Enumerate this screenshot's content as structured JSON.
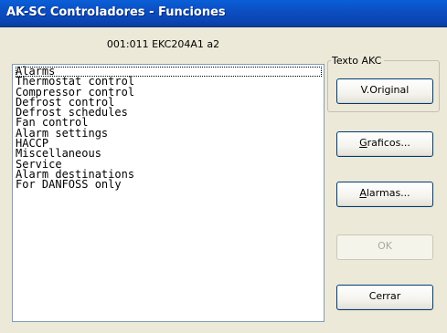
{
  "window": {
    "title": "AK-SC Controladores - Funciones"
  },
  "device_line": "001:011  EKC204A1 a2",
  "list": {
    "items": [
      "Alarms",
      "Thermostat control",
      "Compressor control",
      "Defrost control",
      "Defrost schedules",
      "Fan control",
      "Alarm settings",
      "HACCP",
      "Miscellaneous",
      "Service",
      "Alarm destinations",
      "For DANFOSS only"
    ],
    "selected_index": 0
  },
  "group": {
    "label": "Texto AKC",
    "button": "V.Original"
  },
  "buttons": {
    "graficos": {
      "mnemonic": "G",
      "rest": "raficos..."
    },
    "alarmas": {
      "mnemonic": "A",
      "rest": "larmas..."
    },
    "ok": "OK",
    "cerrar": "Cerrar"
  }
}
